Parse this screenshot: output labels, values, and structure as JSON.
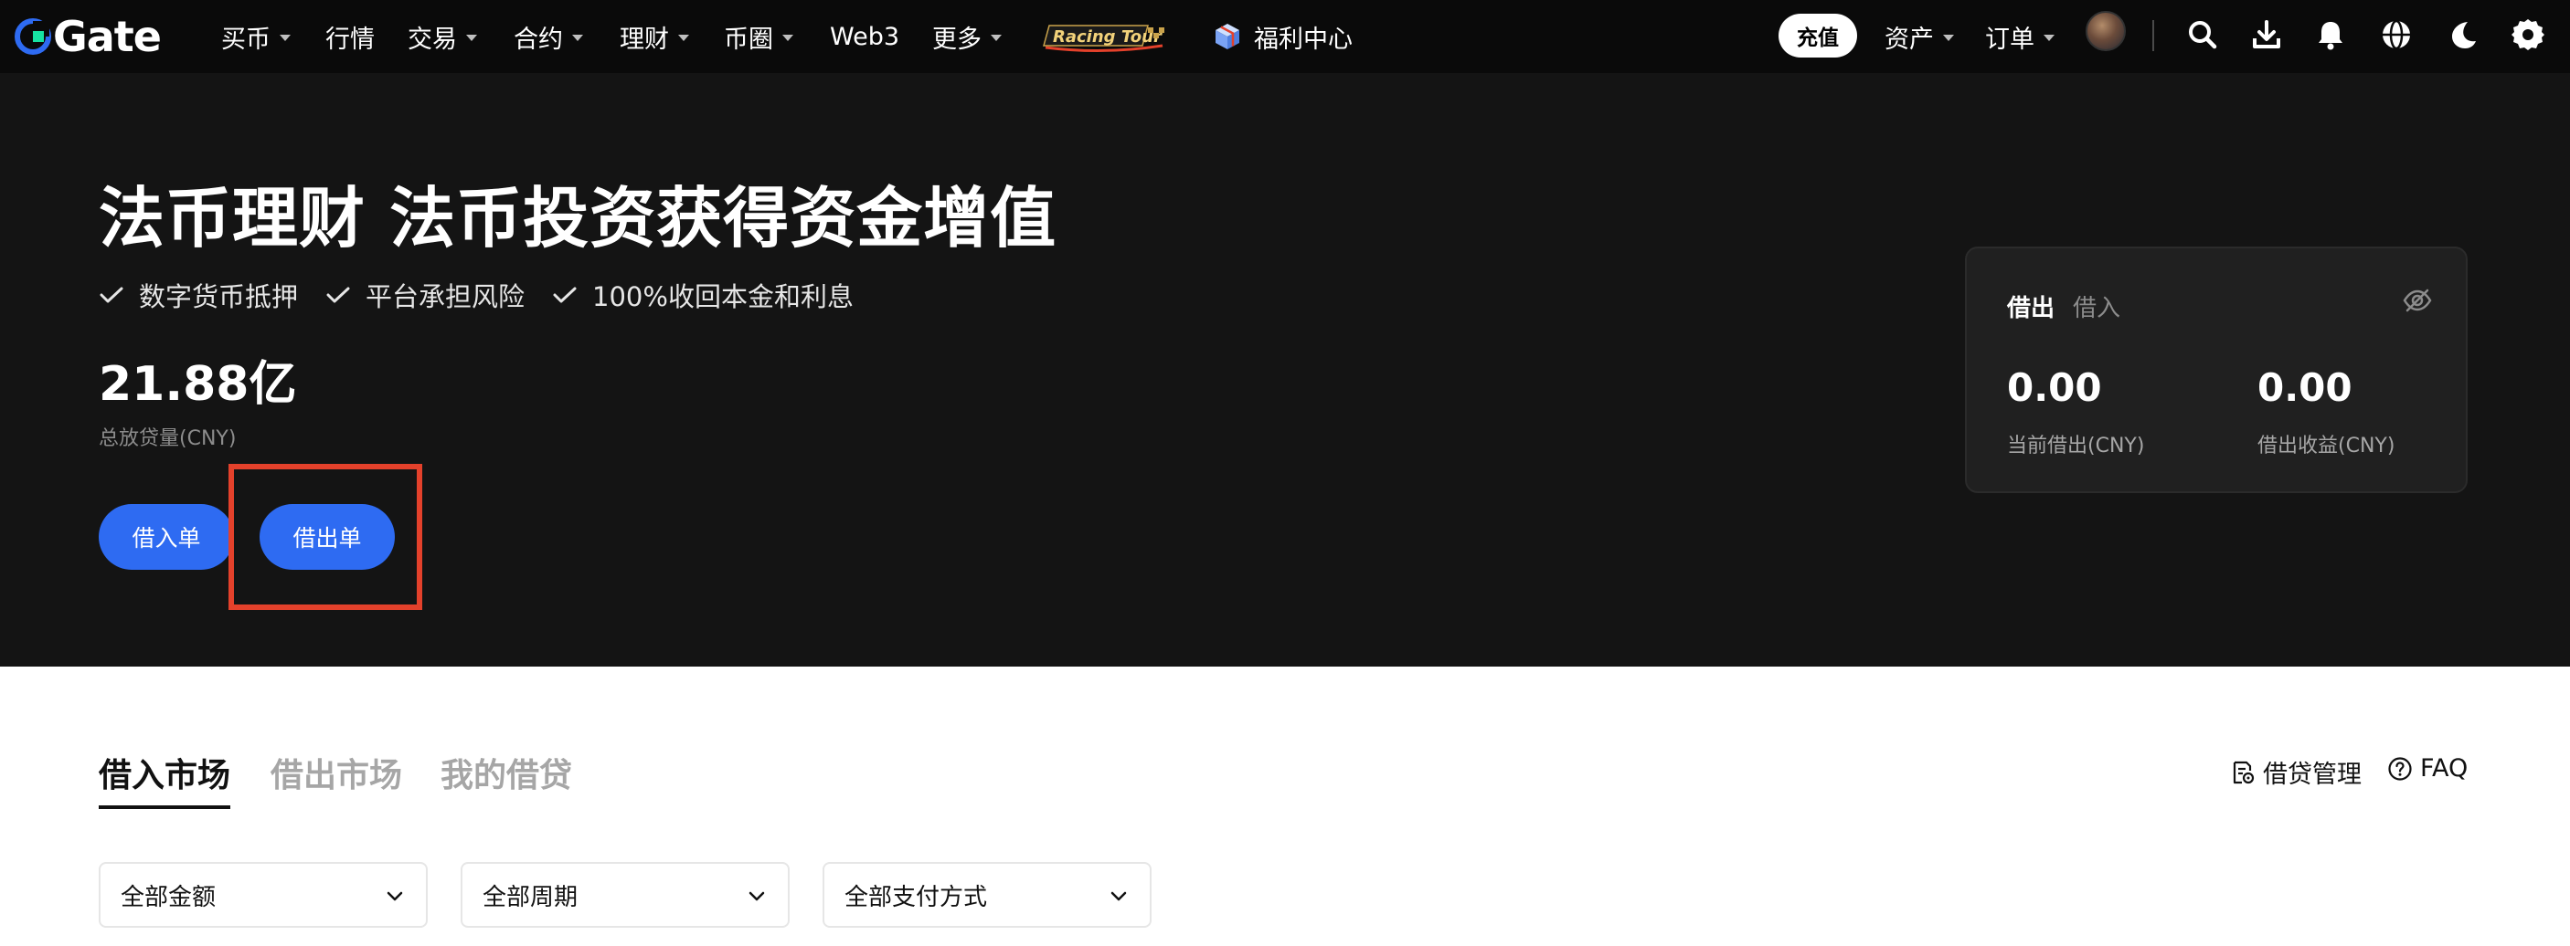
{
  "nav": {
    "logo_text": "Gate",
    "items": [
      {
        "label": "买币",
        "has_caret": true
      },
      {
        "label": "行情",
        "has_caret": false
      },
      {
        "label": "交易",
        "has_caret": true
      },
      {
        "label": "合约",
        "has_caret": true
      },
      {
        "label": "理财",
        "has_caret": true
      },
      {
        "label": "币圈",
        "has_caret": true
      },
      {
        "label": "Web3",
        "has_caret": false
      },
      {
        "label": "更多",
        "has_caret": true
      }
    ],
    "racing_label": "Racing Tour",
    "welfare_label": "福利中心",
    "recharge_label": "充值",
    "assets_label": "资产",
    "orders_label": "订单",
    "icons": [
      "search-icon",
      "download-icon",
      "bell-icon",
      "globe-icon",
      "moon-icon",
      "gear-icon"
    ]
  },
  "hero": {
    "title": "法币理财 法币投资获得资金增值",
    "features": [
      "数字货币抵押",
      "平台承担风险",
      "100%收回本金和利息"
    ],
    "total_value": "21.88亿",
    "total_label": "总放贷量(CNY)",
    "borrow_order_label": "借入单",
    "lend_order_label": "借出单"
  },
  "card": {
    "tab_active": "借出",
    "tab_inactive": "借入",
    "current_lend_value": "0.00",
    "current_lend_label": "当前借出(CNY)",
    "lend_income_value": "0.00",
    "lend_income_label": "借出收益(CNY)"
  },
  "market": {
    "tabs": [
      "借入市场",
      "借出市场",
      "我的借贷"
    ],
    "active_tab": 0,
    "loan_management_label": "借贷管理",
    "faq_label": "FAQ",
    "filters": [
      "全部金额",
      "全部周期",
      "全部支付方式"
    ]
  },
  "colors": {
    "accent_blue": "#2e6bf2",
    "highlight_red": "#e4412b",
    "hero_bg": "#141414",
    "nav_bg": "#0a0a0a"
  }
}
